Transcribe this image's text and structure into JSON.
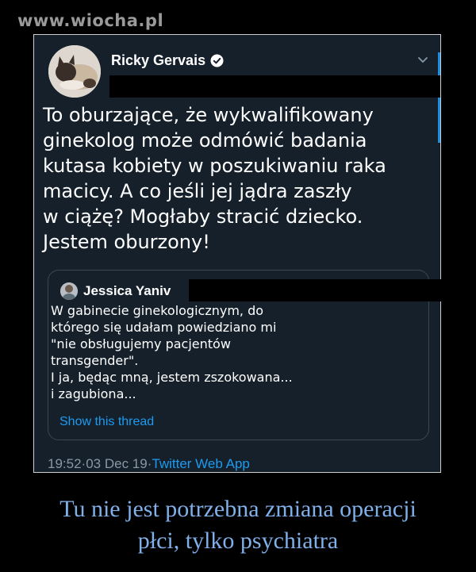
{
  "watermark": {
    "text": "www.wiocha.pl"
  },
  "tweet": {
    "author_name": "Ricky Gervais",
    "verified_icon": "verified-badge-icon",
    "text": "To oburzające, że wykwalifikowany\nginekolog może odmówić badania\nkutasa kobiety w poszukiwaniu raka\nmacicy. A co jeśli jej jądra zaszły\nw ciążę? Mogłaby stracić dziecko.\nJestem oburzony!",
    "time": "19:52",
    "separator": " · ",
    "date": "03 Dec 19",
    "source": "Twitter Web App"
  },
  "quote": {
    "author_name": "Jessica Yaniv",
    "text": "W gabinecie ginekologicznym, do\nktórego się udałam powiedziano mi\n\"nie obsługujemy pacjentów\ntransgender\".\nI ja, będąc mną, jestem zszokowana...\ni zagubiona...",
    "show_thread": "Show this thread"
  },
  "caption": {
    "text": "Tu nie jest potrzebna zmiana operacji\npłci, tylko psychiatra"
  },
  "colors": {
    "tweet_bg": "#15202b",
    "link": "#1d9bf0",
    "caption": "#7fb0ea",
    "watermark": "#9a9a9a"
  }
}
